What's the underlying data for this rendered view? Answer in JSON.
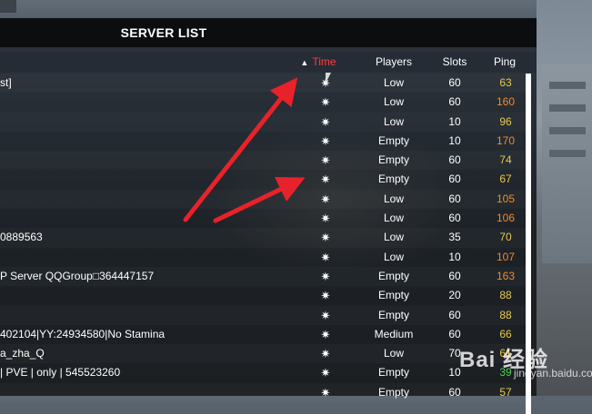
{
  "window": {
    "title": "SERVER LIST"
  },
  "columns": {
    "time": "Time",
    "players": "Players",
    "slots": "Slots",
    "ping": "Ping"
  },
  "colors": {
    "ping_yellow": "#e8c94a",
    "ping_orange": "#f08a2a",
    "ping_green": "#4fd05a",
    "sort_active": "#ff3b3b",
    "annotation_arrow": "#e8222a"
  },
  "icons": {
    "time_icon": "sun-icon",
    "sort_icon": "sort-asc-icon"
  },
  "rows": [
    {
      "name": "st]",
      "time": "✷",
      "players": "Low",
      "slots": "60",
      "ping": "63",
      "ping_color": "#e8c94a"
    },
    {
      "name": "",
      "time": "✷",
      "players": "Low",
      "slots": "60",
      "ping": "160",
      "ping_color": "#f08a2a"
    },
    {
      "name": "",
      "time": "✷",
      "players": "Low",
      "slots": "10",
      "ping": "96",
      "ping_color": "#e8c94a"
    },
    {
      "name": "",
      "time": "✷",
      "players": "Empty",
      "slots": "10",
      "ping": "170",
      "ping_color": "#f08a2a"
    },
    {
      "name": "",
      "time": "✷",
      "players": "Empty",
      "slots": "60",
      "ping": "74",
      "ping_color": "#e8c94a"
    },
    {
      "name": "",
      "time": "✷",
      "players": "Empty",
      "slots": "60",
      "ping": "67",
      "ping_color": "#e8c94a"
    },
    {
      "name": "",
      "time": "✷",
      "players": "Low",
      "slots": "60",
      "ping": "105",
      "ping_color": "#f08a2a"
    },
    {
      "name": "",
      "time": "✷",
      "players": "Low",
      "slots": "60",
      "ping": "106",
      "ping_color": "#f08a2a"
    },
    {
      "name": "0889563",
      "time": "✷",
      "players": "Low",
      "slots": "35",
      "ping": "70",
      "ping_color": "#e8c94a"
    },
    {
      "name": "",
      "time": "✷",
      "players": "Low",
      "slots": "10",
      "ping": "107",
      "ping_color": "#f08a2a"
    },
    {
      "name": "P Server QQGroup□364447157",
      "time": "✷",
      "players": "Empty",
      "slots": "60",
      "ping": "163",
      "ping_color": "#f08a2a"
    },
    {
      "name": "",
      "time": "✷",
      "players": "Empty",
      "slots": "20",
      "ping": "88",
      "ping_color": "#e8c94a"
    },
    {
      "name": "",
      "time": "✷",
      "players": "Empty",
      "slots": "60",
      "ping": "88",
      "ping_color": "#e8c94a"
    },
    {
      "name": "402104|YY:24934580|No Stamina",
      "time": "✷",
      "players": "Medium",
      "slots": "60",
      "ping": "66",
      "ping_color": "#e8c94a"
    },
    {
      "name": "a_zha_Q",
      "time": "✷",
      "players": "Low",
      "slots": "70",
      "ping": "61",
      "ping_color": "#e8c94a"
    },
    {
      "name": "| PVE | only | 545523260",
      "time": "✷",
      "players": "Empty",
      "slots": "10",
      "ping": "39",
      "ping_color": "#4fd05a"
    },
    {
      "name": "",
      "time": "✷",
      "players": "Empty",
      "slots": "60",
      "ping": "57",
      "ping_color": "#e8c94a"
    }
  ],
  "watermark": {
    "text": "Bai 经验",
    "sub": "jingyan.baidu.com"
  }
}
